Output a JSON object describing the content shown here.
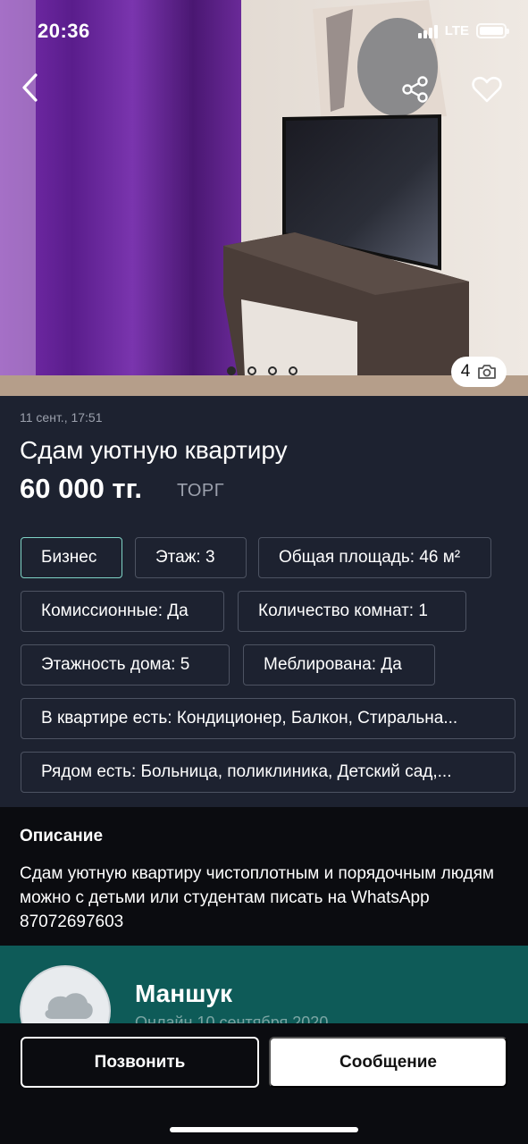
{
  "status_bar": {
    "time": "20:36",
    "network": "LTE"
  },
  "photo": {
    "count": "4",
    "total_dots": 4,
    "active_dot": 0
  },
  "listing": {
    "date": "11 сент., 17:51",
    "title": "Сдам уютную квартиру",
    "price": "60 000 тг.",
    "bargain": "ТОРГ"
  },
  "chips": [
    "Бизнес",
    "Этаж: 3",
    "Общая площадь: 46 м²",
    "Комиссионные: Да",
    "Количество комнат: 1",
    "Этажность дома: 5",
    "Меблирована: Да",
    "В квартире есть: Кондиционер, Балкон, Стиральна...",
    "Рядом есть: Больница, поликлиника, Детский сад,..."
  ],
  "description": {
    "heading": "Описание",
    "text": "Сдам уютную квартиру чистоплотным и порядочным людям можно с детьми или студентам писать на WhatsApp 87072697603"
  },
  "seller": {
    "name": "Маншук",
    "status": "Онлайн 10 сентября 2020"
  },
  "actions": {
    "call_label": "Позвонить",
    "message_label": "Сообщение"
  },
  "colors": {
    "background": "#1d2230",
    "accent": "#7fd3c6",
    "seller_bg": "#0e5b58",
    "description_bg": "#0b0c10"
  }
}
